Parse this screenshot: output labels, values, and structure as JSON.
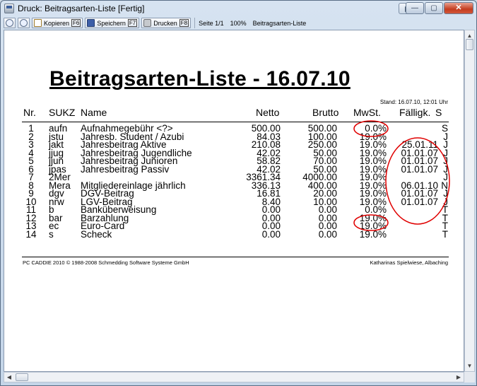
{
  "window": {
    "title": "Druck: Beitragsarten-Liste [Fertig]",
    "buttons": {
      "minimize": "—",
      "maximize": "▢",
      "close": "✕"
    }
  },
  "toolbar": {
    "kopieren": "Kopieren",
    "kopieren_key": "F6",
    "speichern": "Speichern",
    "speichern_key": "F7",
    "drucken": "Drucken",
    "drucken_key": "F8",
    "page": "Seite 1/1",
    "zoom": "100%",
    "doc_name": "Beitragsarten-Liste"
  },
  "report": {
    "title": "Beitragsarten-Liste - 16.07.10",
    "stand": "Stand: 16.07.10, 12:01 Uhr",
    "headers": {
      "nr": "Nr.",
      "sukz": "SUKZ",
      "name": "Name",
      "netto": "Netto",
      "brutto": "Brutto",
      "mwst": "MwSt.",
      "fall": "Fälligk.",
      "s": "S"
    },
    "rows": [
      {
        "nr": "1",
        "sukz": "aufn",
        "name": "Aufnahmegebühr <?>",
        "netto": "500.00",
        "brutto": "500.00",
        "mwst": "0.0%",
        "fall": "",
        "s": "S"
      },
      {
        "nr": "2",
        "sukz": "jstu",
        "name": "Jahresb. Student / Azubi",
        "netto": "84.03",
        "brutto": "100.00",
        "mwst": "19.0%",
        "fall": "",
        "s": "J"
      },
      {
        "nr": "3",
        "sukz": "jakt",
        "name": "Jahresbeitrag Aktive",
        "netto": "210.08",
        "brutto": "250.00",
        "mwst": "19.0%",
        "fall": "25.01.11",
        "s": "J"
      },
      {
        "nr": "4",
        "sukz": "jjug",
        "name": "Jahresbeitrag Jugendliche",
        "netto": "42.02",
        "brutto": "50.00",
        "mwst": "19.0%",
        "fall": "01.01.07",
        "s": "J"
      },
      {
        "nr": "5",
        "sukz": "jjun",
        "name": "Jahresbeitrag Junioren",
        "netto": "58.82",
        "brutto": "70.00",
        "mwst": "19.0%",
        "fall": "01.01.07",
        "s": "J"
      },
      {
        "nr": "6",
        "sukz": "jpas",
        "name": "Jahresbeitrag Passiv",
        "netto": "42.02",
        "brutto": "50.00",
        "mwst": "19.0%",
        "fall": "01.01.07",
        "s": "J"
      },
      {
        "nr": "7",
        "sukz": "2Mer",
        "name": "",
        "netto": "3361.34",
        "brutto": "4000.00",
        "mwst": "19.0%",
        "fall": "",
        "s": "J"
      },
      {
        "nr": "8",
        "sukz": "Mera",
        "name": "Mitgliedereinlage jährlich",
        "netto": "336.13",
        "brutto": "400.00",
        "mwst": "19.0%",
        "fall": "06.01.10",
        "s": "N"
      },
      {
        "nr": "9",
        "sukz": "dgv",
        "name": "DGV-Beitrag",
        "netto": "16.81",
        "brutto": "20.00",
        "mwst": "19.0%",
        "fall": "01.01.07",
        "s": "J"
      },
      {
        "nr": "10",
        "sukz": "nrw",
        "name": "LGV-Beitrag",
        "netto": "8.40",
        "brutto": "10.00",
        "mwst": "19.0%",
        "fall": "01.01.07",
        "s": "J"
      },
      {
        "nr": "11",
        "sukz": "b",
        "name": "Banküberweisung",
        "netto": "0.00",
        "brutto": "0.00",
        "mwst": "0.0%",
        "fall": "",
        "s": "T"
      },
      {
        "nr": "12",
        "sukz": "bar",
        "name": "Barzahlung",
        "netto": "0.00",
        "brutto": "0.00",
        "mwst": "19.0%",
        "fall": "",
        "s": "T"
      },
      {
        "nr": "13",
        "sukz": "ec",
        "name": "Euro-Card",
        "netto": "0.00",
        "brutto": "0.00",
        "mwst": "19.0%",
        "fall": "",
        "s": "T"
      },
      {
        "nr": "14",
        "sukz": "s",
        "name": "Scheck",
        "netto": "0.00",
        "brutto": "0.00",
        "mwst": "19.0%",
        "fall": "",
        "s": "T"
      }
    ],
    "footer_left": "PC CADDIE 2010  © 1988-2008 Schmedding Software Systeme GmbH",
    "footer_right": "Katharinas Spielwiese, Albaching"
  },
  "colors": {
    "annotation": "#e00000",
    "title_bar": "#cfdbe8"
  }
}
